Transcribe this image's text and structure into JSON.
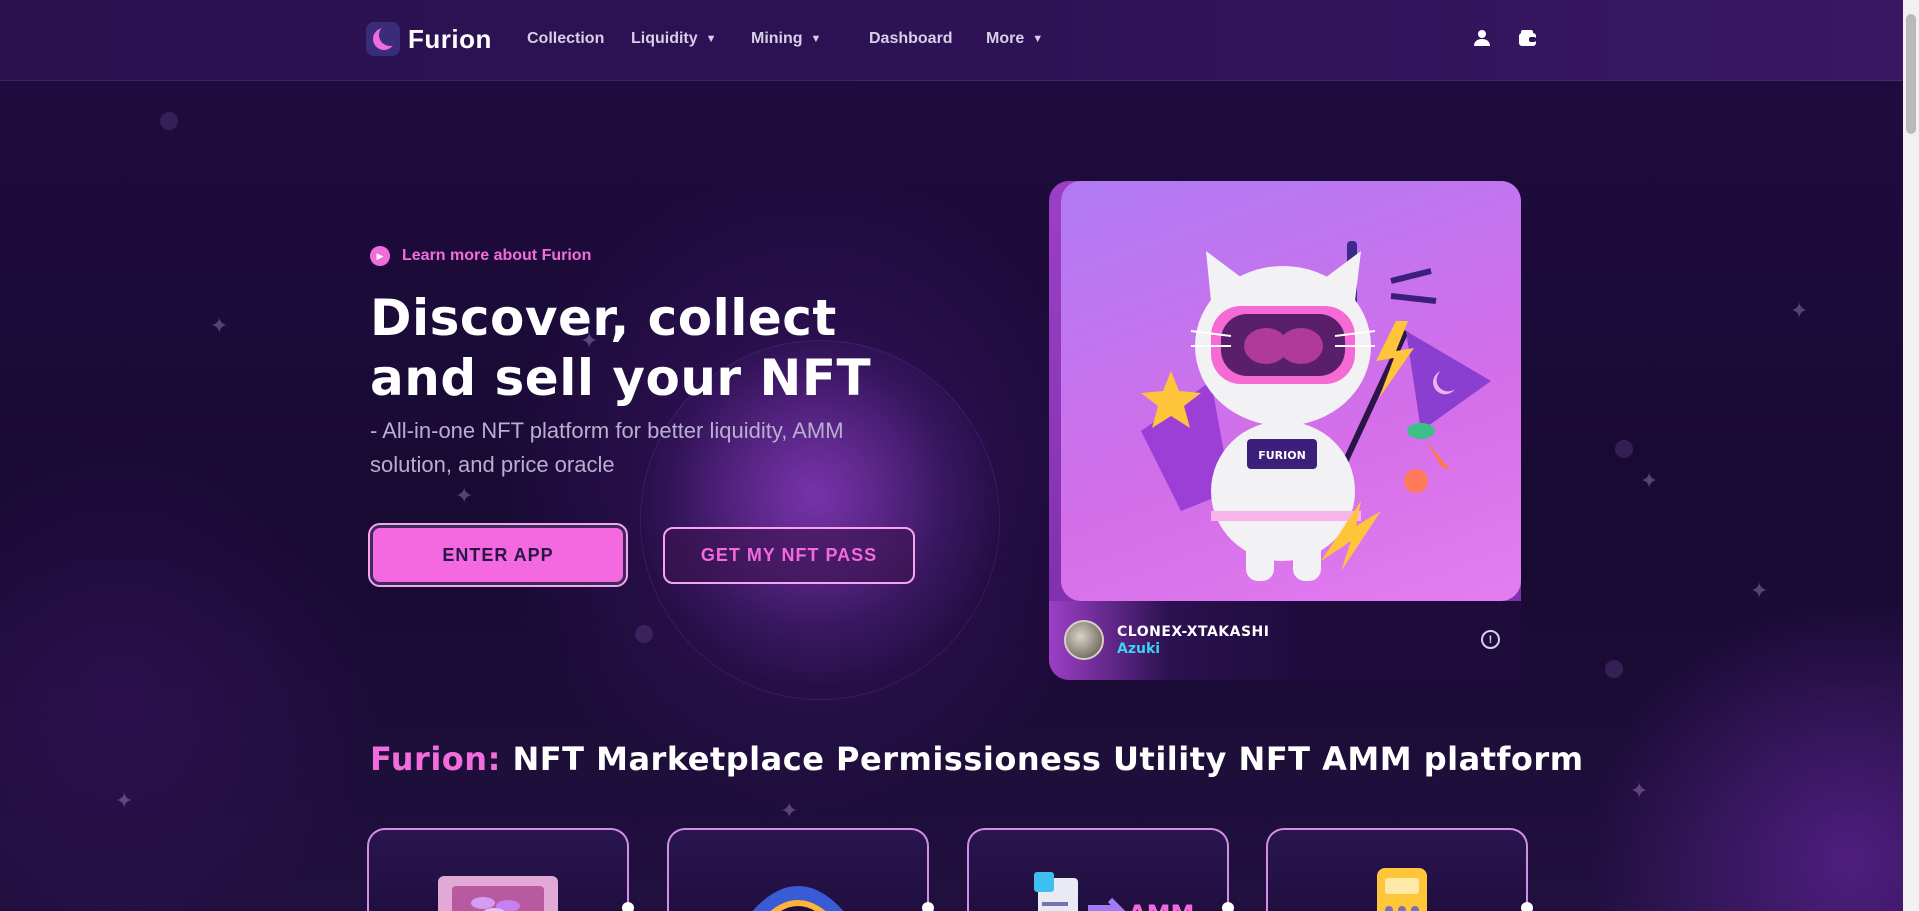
{
  "header": {
    "logo_text": "Furion",
    "nav": [
      {
        "label": "Collection",
        "has_dropdown": false
      },
      {
        "label": "Liquidity",
        "has_dropdown": true
      },
      {
        "label": "Mining",
        "has_dropdown": true
      },
      {
        "label": "Dashboard",
        "has_dropdown": false
      },
      {
        "label": "More",
        "has_dropdown": true
      }
    ],
    "icons": [
      "user-icon",
      "wallet-icon"
    ]
  },
  "hero": {
    "learn_more": "Learn more about Furion",
    "title": "Discover, collect and sell your NFT",
    "subtitle": "- All-in-one NFT platform for better liquidity, AMM solution, and price oracle",
    "enter_app": "ENTER APP",
    "nft_pass": "GET MY NFT PASS"
  },
  "nft_card": {
    "badge_text": "FURION",
    "name": "CLONEX-XTAKASHI",
    "collection": "Azuki"
  },
  "section": {
    "brand": "Furion:",
    "title": "NFT Marketplace Permissioness Utility NFT AMM platform"
  },
  "features": [
    {
      "icon": "nft-box-icon"
    },
    {
      "icon": "vr-headset-icon"
    },
    {
      "icon": "amm-icon",
      "label": "AMM"
    },
    {
      "icon": "calculator-icon"
    }
  ],
  "colors": {
    "accent": "#f26ddc",
    "background": "#1a0b35",
    "link": "#3ad3f0"
  }
}
